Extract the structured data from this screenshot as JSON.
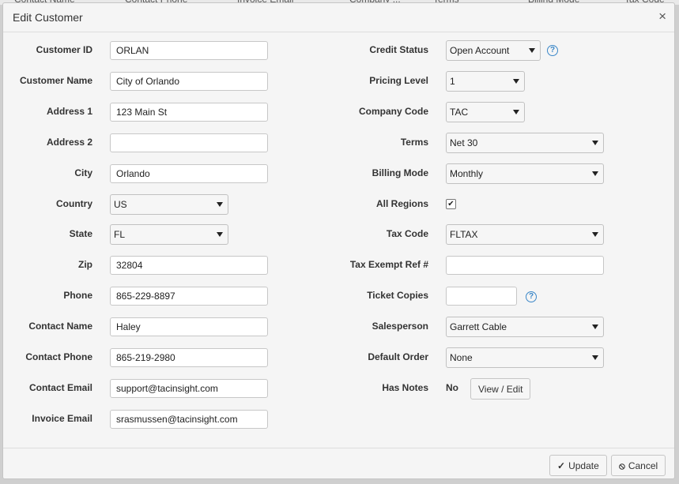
{
  "background_columns": [
    "Contact Name",
    "Contact Phone",
    "Invoice Email",
    "Company ...",
    "Terms",
    "Billing Mode",
    "Tax Code"
  ],
  "dialog": {
    "title": "Edit Customer",
    "close_glyph": "×"
  },
  "left_fields": [
    {
      "label": "Customer ID",
      "type": "text",
      "value": "ORLAN"
    },
    {
      "label": "Customer Name",
      "type": "text",
      "value": "City of Orlando"
    },
    {
      "label": "Address 1",
      "type": "text",
      "value": "123 Main St"
    },
    {
      "label": "Address 2",
      "type": "text",
      "value": ""
    },
    {
      "label": "City",
      "type": "text",
      "value": "Orlando"
    },
    {
      "label": "Country",
      "type": "select",
      "value": "US"
    },
    {
      "label": "State",
      "type": "select",
      "value": "FL"
    },
    {
      "label": "Zip",
      "type": "text",
      "value": "32804"
    },
    {
      "label": "Phone",
      "type": "text",
      "value": "865-229-8897"
    },
    {
      "label": "Contact Name",
      "type": "text",
      "value": "Haley"
    },
    {
      "label": "Contact Phone",
      "type": "text",
      "value": "865-219-2980"
    },
    {
      "label": "Contact Email",
      "type": "text",
      "value": "support@tacinsight.com"
    },
    {
      "label": "Invoice Email",
      "type": "text",
      "value": "srasmussen@tacinsight.com"
    }
  ],
  "right_fields": [
    {
      "label": "Credit Status",
      "type": "select",
      "value": "Open Account"
    },
    {
      "label": "Pricing Level",
      "type": "select",
      "value": "1"
    },
    {
      "label": "Company Code",
      "type": "select",
      "value": "TAC"
    },
    {
      "label": "Terms",
      "type": "select",
      "value": "Net 30"
    },
    {
      "label": "Billing Mode",
      "type": "select",
      "value": "Monthly"
    },
    {
      "label": "All Regions",
      "type": "checkbox",
      "checked": true
    },
    {
      "label": "Tax Code",
      "type": "select",
      "value": "FLTAX"
    },
    {
      "label": "Tax Exempt Ref #",
      "type": "text",
      "value": ""
    },
    {
      "label": "Ticket Copies",
      "type": "text",
      "value": ""
    },
    {
      "label": "Salesperson",
      "type": "select",
      "value": "Garrett Cable"
    },
    {
      "label": "Default Order",
      "type": "select",
      "value": "None"
    },
    {
      "label": "Has Notes",
      "type": "notes",
      "value": "No",
      "button_label": "View / Edit"
    }
  ],
  "help_glyph": "?",
  "check_glyph": "✔",
  "footer": {
    "update_label": "Update",
    "update_icon": "check-icon",
    "cancel_label": "Cancel",
    "cancel_icon": "cancel-circle-icon"
  }
}
